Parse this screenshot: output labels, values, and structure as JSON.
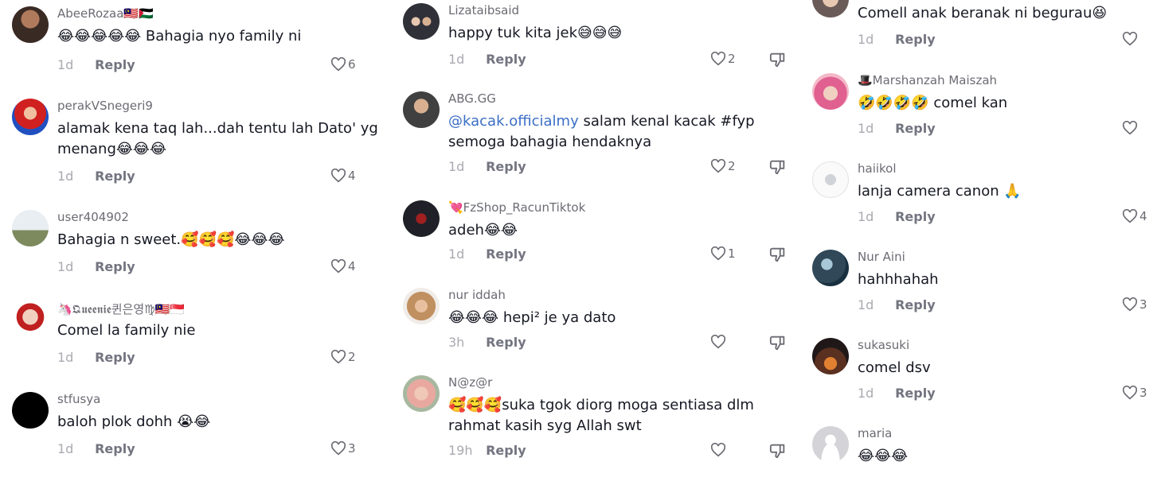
{
  "columns": [
    {
      "comments": [
        {
          "username": "AbeeRozaa🇲🇾🇵🇸",
          "text_lines": [
            "😂😂😂😂😂 Bahagia nyo family ni"
          ],
          "time": "1d",
          "reply": "Reply",
          "likes": "6"
        },
        {
          "username": "perakVSnegeri9",
          "text_lines": [
            "alamak kena taq lah...dah tentu lah Dato' yg",
            "menang😂😂😂"
          ],
          "time": "1d",
          "reply": "Reply",
          "likes": "4"
        },
        {
          "username": "user404902",
          "text_lines": [
            "Bahagia n sweet.🥰🥰🥰😂😂😂"
          ],
          "time": "1d",
          "reply": "Reply",
          "likes": "4"
        },
        {
          "username": "🦄𝕼𝖚𝖊𝖊𝖓𝖎𝖊퀸은영♍🇲🇾🇸🇬",
          "text_lines": [
            "Comel la family nie"
          ],
          "time": "1d",
          "reply": "Reply",
          "likes": "2"
        },
        {
          "username": "stfusya",
          "text_lines": [
            "baloh plok dohh 😭😂"
          ],
          "time": "1d",
          "reply": "Reply",
          "likes": "3"
        }
      ]
    },
    {
      "comments": [
        {
          "username": "Lizataibsaid",
          "text_lines": [
            "happy tuk kita jek😅😅😅"
          ],
          "time": "1d",
          "reply": "Reply",
          "likes": "2"
        },
        {
          "username": "ABG.GG",
          "mention": "@kacak.officialmy",
          "text_lines": [
            " salam kenal kacak #fyp",
            "semoga bahagia hendaknya"
          ],
          "time": "1d",
          "reply": "Reply",
          "likes": "2"
        },
        {
          "username": "💘FzShop_RacunTiktok",
          "text_lines": [
            "adeh😂😂"
          ],
          "time": "1d",
          "reply": "Reply",
          "likes": "1"
        },
        {
          "username": "nur iddah",
          "text_lines": [
            "😂😂😂 hepi² je ya dato"
          ],
          "time": "3h",
          "reply": "Reply",
          "likes": ""
        },
        {
          "username": "N@z@r",
          "text_lines": [
            "🥰🥰🥰suka tgok diorg moga sentiasa dlm",
            "rahmat kasih syg Allah swt"
          ],
          "time": "19h",
          "reply": "Reply",
          "likes": ""
        }
      ]
    },
    {
      "comments": [
        {
          "username": "",
          "text_lines": [
            "Comell anak beranak ni begurau😆"
          ],
          "time": "1d",
          "reply": "Reply",
          "likes": ""
        },
        {
          "username": "🎩Marshanzah Maiszah",
          "text_lines": [
            "🤣🤣🤣🤣 comel kan"
          ],
          "time": "1d",
          "reply": "Reply",
          "likes": ""
        },
        {
          "username": "haiikol",
          "text_lines": [
            "lanja camera canon 🙏"
          ],
          "time": "1d",
          "reply": "Reply",
          "likes": "4"
        },
        {
          "username": "Nur Aini",
          "text_lines": [
            "hahhhahah"
          ],
          "time": "1d",
          "reply": "Reply",
          "likes": "3"
        },
        {
          "username": "sukasuki",
          "text_lines": [
            "comel dsv"
          ],
          "time": "1d",
          "reply": "Reply",
          "likes": "3"
        },
        {
          "username": "maria",
          "text_lines": [
            "😂😂😂"
          ],
          "time": "",
          "reply": "",
          "likes": ""
        }
      ]
    }
  ],
  "icons": {
    "like": "heart-outline-icon",
    "dislike": "thumbs-down-icon"
  },
  "colors": {
    "text": "#161823",
    "username": "#6b6b73",
    "meta": "#8a8b91",
    "mention": "#3b6ec5"
  }
}
